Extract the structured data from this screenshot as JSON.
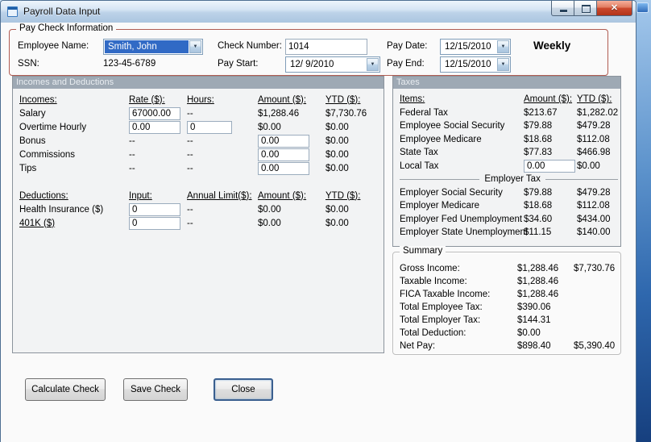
{
  "window": {
    "title": "Payroll Data Input"
  },
  "paycheck": {
    "group_title": "Pay Check Information",
    "employee_name": {
      "label": "Employee Name:",
      "value": "Smith, John"
    },
    "ssn": {
      "label": "SSN:",
      "value": "123-45-6789"
    },
    "check_number": {
      "label": "Check Number:",
      "value": "1014"
    },
    "pay_start": {
      "label": "Pay Start:",
      "value": "12/ 9/2010"
    },
    "pay_date": {
      "label": "Pay Date:",
      "value": "12/15/2010"
    },
    "pay_end": {
      "label": "Pay End:",
      "value": "12/15/2010"
    },
    "frequency": "Weekly"
  },
  "incomes": {
    "header": "Incomes and Deductions",
    "col_headers": {
      "name": "Incomes:",
      "rate": "Rate ($):",
      "hours": "Hours:",
      "amount": "Amount ($):",
      "ytd": "YTD ($):"
    },
    "rows": [
      {
        "name": "Salary",
        "rate": "67000.00",
        "hours": "--",
        "amount": "$1,288.46",
        "ytd": "$7,730.76"
      },
      {
        "name": "Overtime Hourly",
        "rate": "0.00",
        "hours": "0",
        "amount": "$0.00",
        "ytd": "$0.00"
      },
      {
        "name": "Bonus",
        "rate": "--",
        "hours": "--",
        "amount": "0.00",
        "ytd": "$0.00"
      },
      {
        "name": "Commissions",
        "rate": "--",
        "hours": "--",
        "amount": "0.00",
        "ytd": "$0.00"
      },
      {
        "name": "Tips",
        "rate": "--",
        "hours": "--",
        "amount": "0.00",
        "ytd": "$0.00"
      }
    ],
    "ded_headers": {
      "name": "Deductions:",
      "input": "Input:",
      "limit": "Annual Limit($):",
      "amount": "Amount ($):",
      "ytd": "YTD ($):"
    },
    "ded_rows": [
      {
        "name": "Health Insurance ($)",
        "input": "0",
        "limit": "--",
        "amount": "$0.00",
        "ytd": "$0.00"
      },
      {
        "name": "401K ($)",
        "input": "0",
        "limit": "--",
        "amount": "$0.00",
        "ytd": "$0.00"
      }
    ]
  },
  "taxes": {
    "header": "Taxes",
    "col_headers": {
      "name": "Items:",
      "amount": "Amount ($):",
      "ytd": "YTD ($):"
    },
    "rows": [
      {
        "name": "Federal Tax",
        "amount": "$213.67",
        "ytd": "$1,282.02"
      },
      {
        "name": "Employee Social Security",
        "amount": "$79.88",
        "ytd": "$479.28"
      },
      {
        "name": "Employee Medicare",
        "amount": "$18.68",
        "ytd": "$112.08"
      },
      {
        "name": "State Tax",
        "amount": "$77.83",
        "ytd": "$466.98"
      },
      {
        "name": "Local Tax",
        "amount": "0.00",
        "ytd": "$0.00"
      }
    ],
    "employer_header": "Employer Tax",
    "employer_rows": [
      {
        "name": "Employer Social Security",
        "amount": "$79.88",
        "ytd": "$479.28"
      },
      {
        "name": "Employer Medicare",
        "amount": "$18.68",
        "ytd": "$112.08"
      },
      {
        "name": "Employer Fed Unemployment",
        "amount": "$34.60",
        "ytd": "$434.00"
      },
      {
        "name": "Employer State Unemployment",
        "amount": "$11.15",
        "ytd": "$140.00"
      }
    ]
  },
  "summary": {
    "group_title": "Summary",
    "rows": [
      {
        "name": "Gross Income:",
        "amount": "$1,288.46",
        "ytd": "$7,730.76"
      },
      {
        "name": "Taxable Income:",
        "amount": "$1,288.46",
        "ytd": ""
      },
      {
        "name": "FICA Taxable Income:",
        "amount": "$1,288.46",
        "ytd": ""
      },
      {
        "name": "Total Employee Tax:",
        "amount": "$390.06",
        "ytd": ""
      },
      {
        "name": "Total Employer Tax:",
        "amount": "$144.31",
        "ytd": ""
      },
      {
        "name": "Total Deduction:",
        "amount": "$0.00",
        "ytd": ""
      },
      {
        "name": "Net Pay:",
        "amount": "$898.40",
        "ytd": "$5,390.40"
      }
    ]
  },
  "actions": {
    "calculate": "Calculate Check",
    "save": "Save Check",
    "close": "Close"
  }
}
